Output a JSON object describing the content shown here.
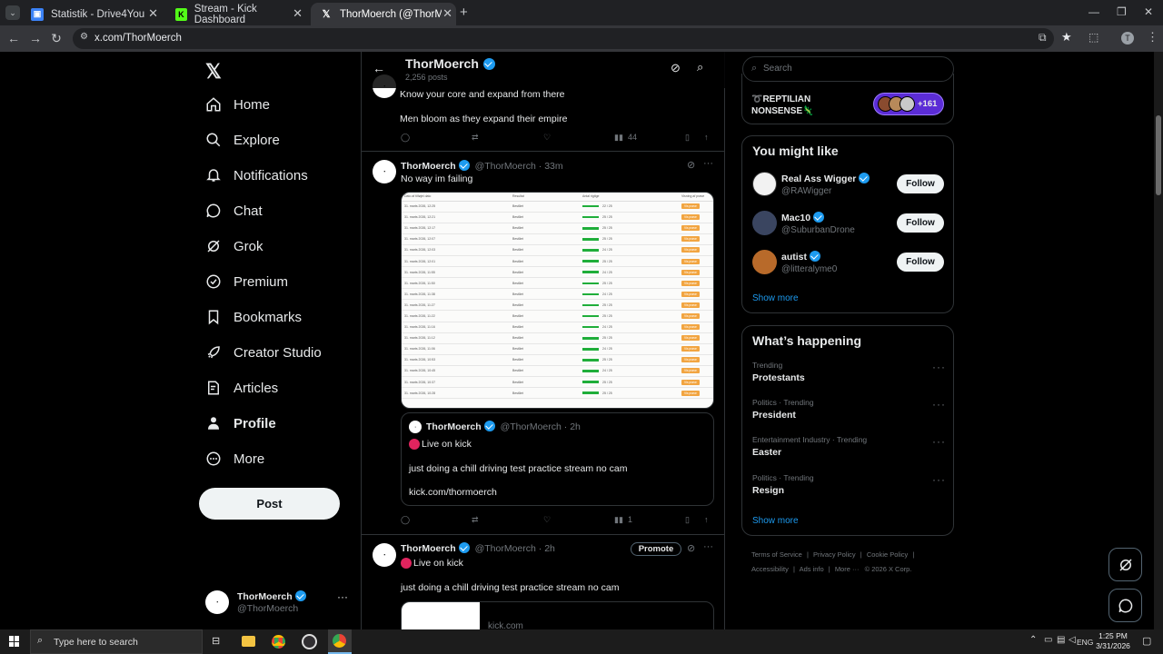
{
  "browser": {
    "tabs": [
      {
        "label": "Statistik - Drive4You",
        "favicon": "drive4you"
      },
      {
        "label": "Stream - Kick Dashboard",
        "favicon": "kick"
      },
      {
        "label": "ThorMoerch (@ThorMoerch) /",
        "favicon": "x"
      }
    ],
    "url": "x.com/ThorMoerch",
    "profile_initial": "T"
  },
  "nav": {
    "items": [
      {
        "label": "Home",
        "icon": "home-icon"
      },
      {
        "label": "Explore",
        "icon": "search-icon"
      },
      {
        "label": "Notifications",
        "icon": "bell-icon"
      },
      {
        "label": "Chat",
        "icon": "chat-icon"
      },
      {
        "label": "Grok",
        "icon": "grok-icon"
      },
      {
        "label": "Premium",
        "icon": "premium-icon"
      },
      {
        "label": "Bookmarks",
        "icon": "bookmark-icon"
      },
      {
        "label": "Creator Studio",
        "icon": "rocket-icon"
      },
      {
        "label": "Articles",
        "icon": "articles-icon"
      },
      {
        "label": "Profile",
        "icon": "person-icon"
      },
      {
        "label": "More",
        "icon": "more-circle-icon"
      }
    ],
    "post_label": "Post",
    "account": {
      "name": "ThorMoerch",
      "handle": "@ThorMoerch"
    }
  },
  "header": {
    "name": "ThorMoerch",
    "posts": "2,256 posts"
  },
  "tweets": {
    "top": {
      "line1": "Know your core and expand from there",
      "line2": "Men bloom as they expand their empire",
      "views": "44"
    },
    "t1": {
      "name": "ThorMoerch",
      "handle": "@ThorMoerch",
      "time": "· 33m",
      "text": "No way im failing",
      "views": "1",
      "quote": {
        "name": "ThorMoerch",
        "handle": "@ThorMoerch",
        "time": "· 2h",
        "line1": "Live on kick",
        "line2": "just doing a chill driving test practice stream no cam",
        "line3": "kick.com/thormoerch"
      }
    },
    "t2": {
      "name": "ThorMoerch",
      "handle": "@ThorMoerch",
      "time": "· 2h",
      "promote": "Promote",
      "line1": "Live on kick",
      "line2": "just doing a chill driving test practice stream no cam",
      "link": "kick.com"
    }
  },
  "screenshot_table": {
    "headers": [
      "Dato af tilføjet dato",
      "Resultat",
      "Antal rigtige",
      "Visning af prøve"
    ],
    "rows": [
      [
        "31. marts 2026, 12:25",
        "Bestået",
        "22 / 25",
        "Vis prøve"
      ],
      [
        "31. marts 2026, 12:21",
        "Bestået",
        "25 / 25",
        "Vis prøve"
      ],
      [
        "31. marts 2026, 12:17",
        "Bestået",
        "25 / 25",
        "Vis prøve"
      ],
      [
        "31. marts 2026, 12:07",
        "Bestået",
        "25 / 25",
        "Vis prøve"
      ],
      [
        "31. marts 2026, 12:03",
        "Bestået",
        "24 / 25",
        "Vis prøve"
      ],
      [
        "31. marts 2026, 12:01",
        "Bestået",
        "25 / 25",
        "Vis prøve"
      ],
      [
        "31. marts 2026, 11:55",
        "Bestået",
        "24 / 25",
        "Vis prøve"
      ],
      [
        "31. marts 2026, 11:50",
        "Bestået",
        "25 / 25",
        "Vis prøve"
      ],
      [
        "31. marts 2026, 11:38",
        "Bestået",
        "24 / 25",
        "Vis prøve"
      ],
      [
        "31. marts 2026, 11:27",
        "Bestået",
        "25 / 25",
        "Vis prøve"
      ],
      [
        "31. marts 2026, 11:22",
        "Bestået",
        "25 / 25",
        "Vis prøve"
      ],
      [
        "31. marts 2026, 11:16",
        "Bestået",
        "24 / 25",
        "Vis prøve"
      ],
      [
        "31. marts 2026, 11:12",
        "Bestået",
        "25 / 25",
        "Vis prøve"
      ],
      [
        "31. marts 2026, 11:06",
        "Bestået",
        "24 / 25",
        "Vis prøve"
      ],
      [
        "31. marts 2026, 10:53",
        "Bestået",
        "25 / 25",
        "Vis prøve"
      ],
      [
        "31. marts 2026, 10:45",
        "Bestået",
        "24 / 25",
        "Vis prøve"
      ],
      [
        "31. marts 2026, 10:37",
        "Bestået",
        "25 / 25",
        "Vis prøve"
      ],
      [
        "31. marts 2026, 10:28",
        "Bestået",
        "25 / 25",
        "Vis prøve"
      ]
    ]
  },
  "right": {
    "search_placeholder": "Search",
    "spaces_title": "REPTILIAN NONSENSE",
    "spaces_count": "+161",
    "you_might_like": {
      "title": "You might like",
      "users": [
        {
          "name": "Real Ass Wigger",
          "handle": "@RAWigger",
          "button": "Follow"
        },
        {
          "name": "Mac10",
          "handle": "@SuburbanDrone",
          "button": "Follow"
        },
        {
          "name": "autist",
          "handle": "@litteralyme0",
          "button": "Follow"
        }
      ],
      "show_more": "Show more"
    },
    "happening": {
      "title": "What’s happening",
      "trends": [
        {
          "category": "Trending",
          "name": "Protestants"
        },
        {
          "category": "Politics · Trending",
          "name": "President"
        },
        {
          "category": "Entertainment Industry · Trending",
          "name": "Easter"
        },
        {
          "category": "Politics · Trending",
          "name": "Resign"
        }
      ],
      "show_more": "Show more"
    },
    "footer": {
      "links": [
        "Terms of Service",
        "Privacy Policy",
        "Cookie Policy",
        "Accessibility",
        "Ads info",
        "More ···"
      ],
      "copyright": "© 2026 X Corp."
    }
  },
  "taskbar": {
    "search_placeholder": "Type here to search",
    "lang": "ENG",
    "time": "1:25 PM",
    "date": "3/31/2026"
  },
  "colors": {
    "accent": "#1d9bf0",
    "kick_green": "#53fc18",
    "live_red": "#e0245e"
  }
}
